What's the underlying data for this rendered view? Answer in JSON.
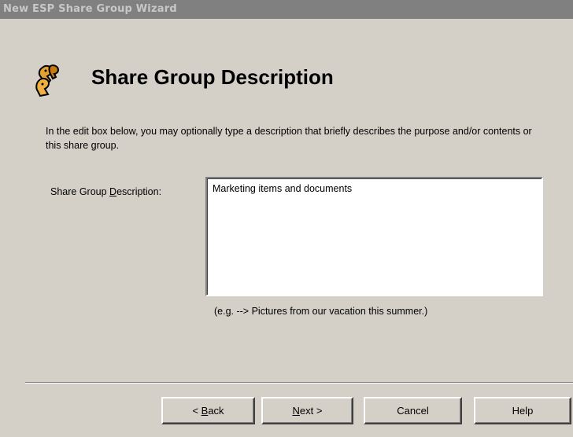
{
  "window": {
    "title": "New ESP Share Group Wizard"
  },
  "page": {
    "icon": "share-group-icon",
    "title": "Share Group Description",
    "description": "In the edit box below, you may optionally type a description that briefly describes the purpose and/or contents or this share group."
  },
  "field": {
    "label_prefix": "Share Group ",
    "label_mnemonic": "D",
    "label_suffix": "escription:",
    "value": "Marketing items and documents",
    "hint": "(e.g. --> Pictures from our vacation this summer.)"
  },
  "buttons": {
    "back": {
      "prefix": "< ",
      "mnemonic": "B",
      "suffix": "ack"
    },
    "next": {
      "prefix": "",
      "mnemonic": "N",
      "suffix": "ext >"
    },
    "cancel": "Cancel",
    "help": "Help"
  },
  "colors": {
    "dialog_bg": "#d4d0c8",
    "titlebar_inactive": "#808080",
    "titlebar_text": "#c8c8c8",
    "icon_fill": "#e6a030",
    "icon_outline": "#000000"
  }
}
